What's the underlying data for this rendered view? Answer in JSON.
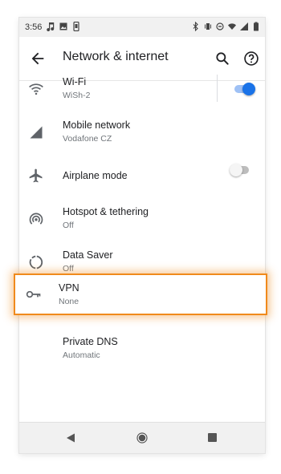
{
  "status_bar": {
    "time": "3:56"
  },
  "app_bar": {
    "title": "Network & internet"
  },
  "items": [
    {
      "title": "Wi-Fi",
      "subtitle": "WiSh-2"
    },
    {
      "title": "Mobile network",
      "subtitle": "Vodafone CZ"
    },
    {
      "title": "Airplane mode",
      "subtitle": ""
    },
    {
      "title": "Hotspot & tethering",
      "subtitle": "Off"
    },
    {
      "title": "Data Saver",
      "subtitle": "Off"
    },
    {
      "title": "VPN",
      "subtitle": "None"
    },
    {
      "title": "Private DNS",
      "subtitle": "Automatic"
    }
  ],
  "toggles": {
    "wifi": true,
    "airplane_mode": false
  },
  "colors": {
    "accent": "#1a73e8",
    "highlight": "#f08a1c",
    "icon": "#5f6368"
  },
  "icons": [
    "wifi-icon",
    "signal-icon",
    "airplane-icon",
    "hotspot-icon",
    "data-saver-icon",
    "vpn-key-icon",
    "search-icon",
    "help-icon",
    "back-arrow-icon"
  ]
}
